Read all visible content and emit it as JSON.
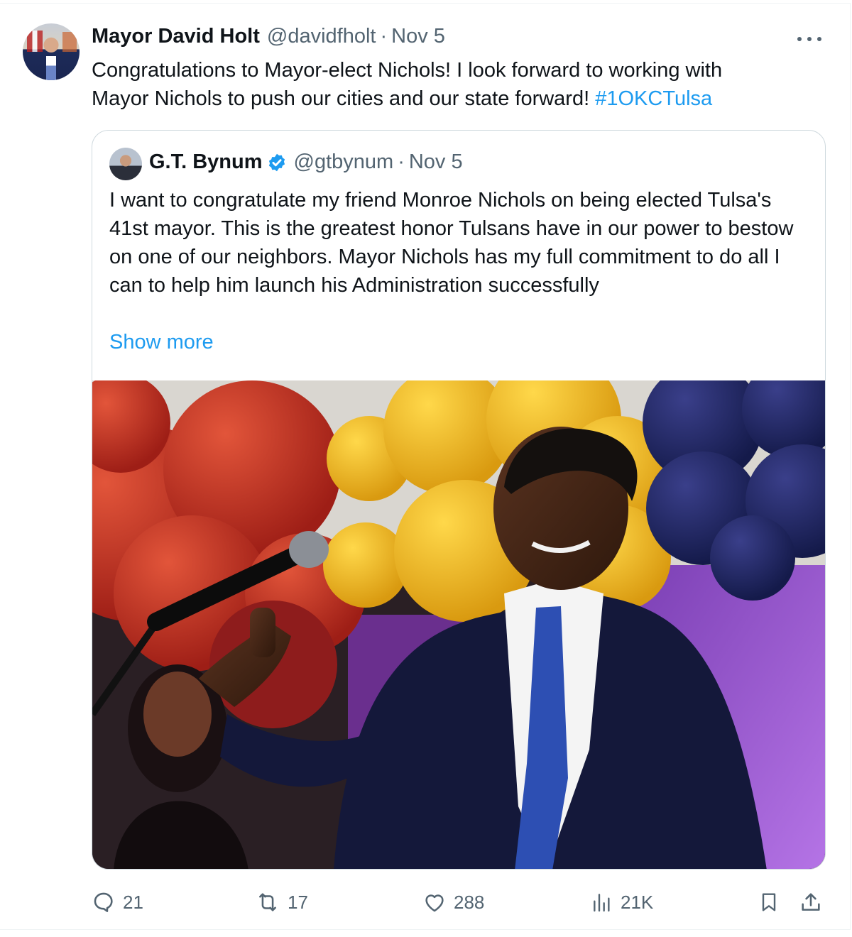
{
  "author": {
    "name": "Mayor David Holt",
    "handle": "@davidfholt",
    "separator": "·",
    "date": "Nov 5"
  },
  "tweet": {
    "line1": "Congratulations to Mayor-elect Nichols!   I look forward to working with",
    "line2": "Mayor Nichols to push our cities and our state forward! ",
    "hashtag": "#1OKCTulsa"
  },
  "quoted": {
    "name": "G.T. Bynum",
    "handle": "@gtbynum",
    "separator": "·",
    "date": "Nov 5",
    "verified": true,
    "text": "I want to congratulate my friend Monroe Nichols on being elected Tulsa's 41st mayor.  This is the greatest honor Tulsans have in our power to bestow on one of our neighbors.  Mayor Nichols has my full commitment to do all I can to help him launch his Administration successfully",
    "show_more": "Show more",
    "image_icon": "photo-of-man-at-podium-with-balloons"
  },
  "actions": {
    "replies": "21",
    "reposts": "17",
    "likes": "288",
    "views": "21K"
  },
  "colors": {
    "link": "#1d9bf0",
    "secondary": "#536471",
    "border": "#cfd9de"
  }
}
